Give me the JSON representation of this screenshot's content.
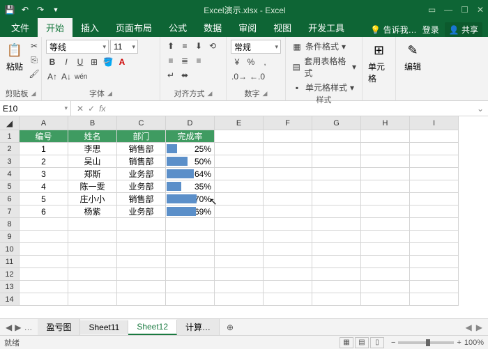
{
  "title": "Excel演示.xlsx - Excel",
  "tabs": {
    "file": "文件",
    "home": "开始",
    "insert": "插入",
    "layout": "页面布局",
    "formula": "公式",
    "data": "数据",
    "review": "审阅",
    "view": "视图",
    "dev": "开发工具",
    "tell": "告诉我…",
    "login": "登录",
    "share": "共享"
  },
  "ribbon": {
    "clipboard": {
      "label": "剪贴板",
      "paste": "粘贴"
    },
    "font": {
      "label": "字体",
      "name": "等线",
      "size": "11"
    },
    "align": {
      "label": "对齐方式"
    },
    "number": {
      "label": "数字",
      "format": "常规"
    },
    "styles": {
      "label": "样式",
      "cond": "条件格式",
      "table": "套用表格格式",
      "cell": "单元格样式"
    },
    "cells": {
      "label": "单元格"
    },
    "editing": {
      "label": "编辑"
    }
  },
  "namebox": "E10",
  "chart_data": {
    "type": "table",
    "headers": [
      "编号",
      "姓名",
      "部门",
      "完成率"
    ],
    "rows": [
      {
        "id": "1",
        "name": "李思",
        "dept": "销售部",
        "rate": "25%",
        "val": 25
      },
      {
        "id": "2",
        "name": "吴山",
        "dept": "销售部",
        "rate": "50%",
        "val": 50
      },
      {
        "id": "3",
        "name": "郑斯",
        "dept": "业务部",
        "rate": "64%",
        "val": 64
      },
      {
        "id": "4",
        "name": "陈一雯",
        "dept": "业务部",
        "rate": "35%",
        "val": 35
      },
      {
        "id": "5",
        "name": "庄小小",
        "dept": "销售部",
        "rate": "70%",
        "val": 70
      },
      {
        "id": "6",
        "name": "杨紫",
        "dept": "业务部",
        "rate": "69%",
        "val": 69
      }
    ]
  },
  "columns": [
    "A",
    "B",
    "C",
    "D",
    "E",
    "F",
    "G",
    "H",
    "I"
  ],
  "sheets": {
    "nav": "…",
    "s1": "盈亏图",
    "s2": "Sheet11",
    "s3": "Sheet12",
    "s4": "计算…"
  },
  "status": {
    "ready": "就绪",
    "zoom": "100%"
  }
}
